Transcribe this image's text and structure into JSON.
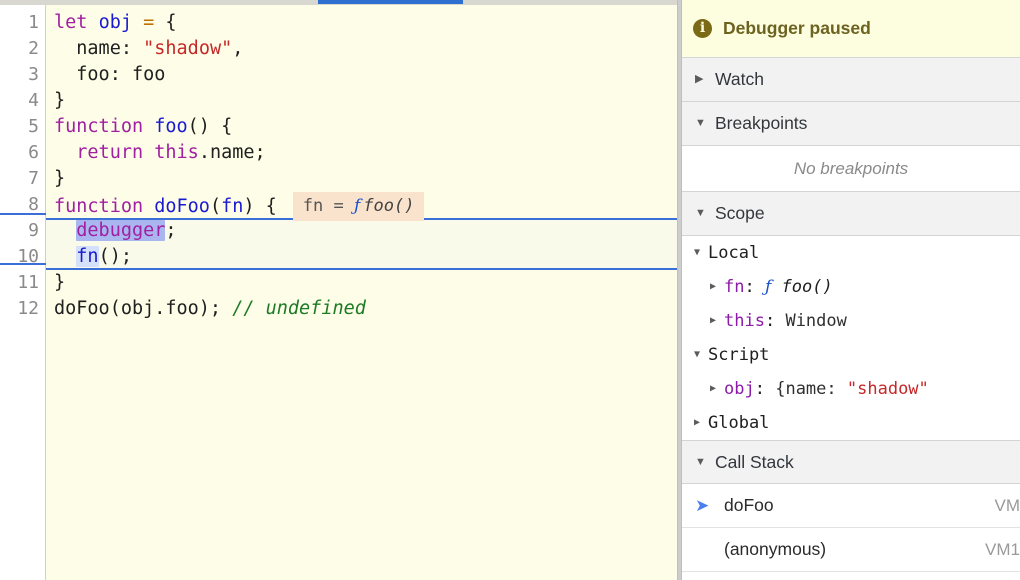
{
  "editor": {
    "line_numbers": [
      "1",
      "2",
      "3",
      "4",
      "5",
      "6",
      "7",
      "8",
      "9",
      "10",
      "11",
      "12"
    ],
    "lines": {
      "l1_kw": "let",
      "l1_id": "obj",
      "l1_op": "=",
      "l1_brace": "{",
      "l2_prop": "name:",
      "l2_str": "\"shadow\"",
      "l2_comma": ",",
      "l3_text": "foo: foo",
      "l4_text": "}",
      "l5_kw": "function",
      "l5_id": "foo",
      "l5_rest": "() {",
      "l6_kw": "return",
      "l6_kw2": "this",
      "l6_rest": ".name;",
      "l7_text": "}",
      "l8_kw": "function",
      "l8_id": "doFoo",
      "l8_lp": "(",
      "l8_param": "fn",
      "l8_rest": ") {",
      "l9_kw": "debugger",
      "l9_semi": ";",
      "l10_id": "fn",
      "l10_rest": "();",
      "l11_text": "}",
      "l12_code": "doFoo(obj.foo);",
      "l12_comment": "// undefined"
    },
    "inline_hint": {
      "expr": "fn =",
      "fglyph": "ƒ",
      "fname": "foo()"
    }
  },
  "sidebar": {
    "paused_banner": {
      "icon": "info-icon",
      "label": "Debugger paused"
    },
    "sections": [
      {
        "title": "Watch",
        "state": "closed"
      },
      {
        "title": "Breakpoints",
        "state": "open"
      },
      {
        "title": "Scope",
        "state": "open"
      },
      {
        "title": "Call Stack",
        "state": "open"
      }
    ],
    "breakpoints": {
      "empty_text": "No breakpoints"
    },
    "scope": {
      "rows": [
        {
          "label": "Local"
        },
        {
          "name": "fn",
          "colon": ":",
          "fglyph": "ƒ",
          "value": "foo()"
        },
        {
          "name": "this",
          "colon": ":",
          "value": "Window"
        },
        {
          "label": "Script"
        },
        {
          "name": "obj",
          "colon": ":",
          "open_brace": "{name:",
          "str": "\"shadow\""
        },
        {
          "label": "Global"
        }
      ]
    },
    "call_stack": {
      "rows": [
        {
          "name": "doFoo",
          "location": "VM",
          "active": true
        },
        {
          "name": "(anonymous)",
          "location": "VM1",
          "active": false
        }
      ]
    }
  },
  "colors": {
    "editor_bg": "#fdfde8",
    "accent_blue": "#2f6fd0",
    "exec_line": "#3a6fd8",
    "hint_bg": "#fae3cd",
    "string_red": "#c62828",
    "keyword_purple": "#a11fa1",
    "ident_blue": "#1a1ad0",
    "comment_green": "#1d7a25",
    "banner_bg": "#fdfde0"
  }
}
